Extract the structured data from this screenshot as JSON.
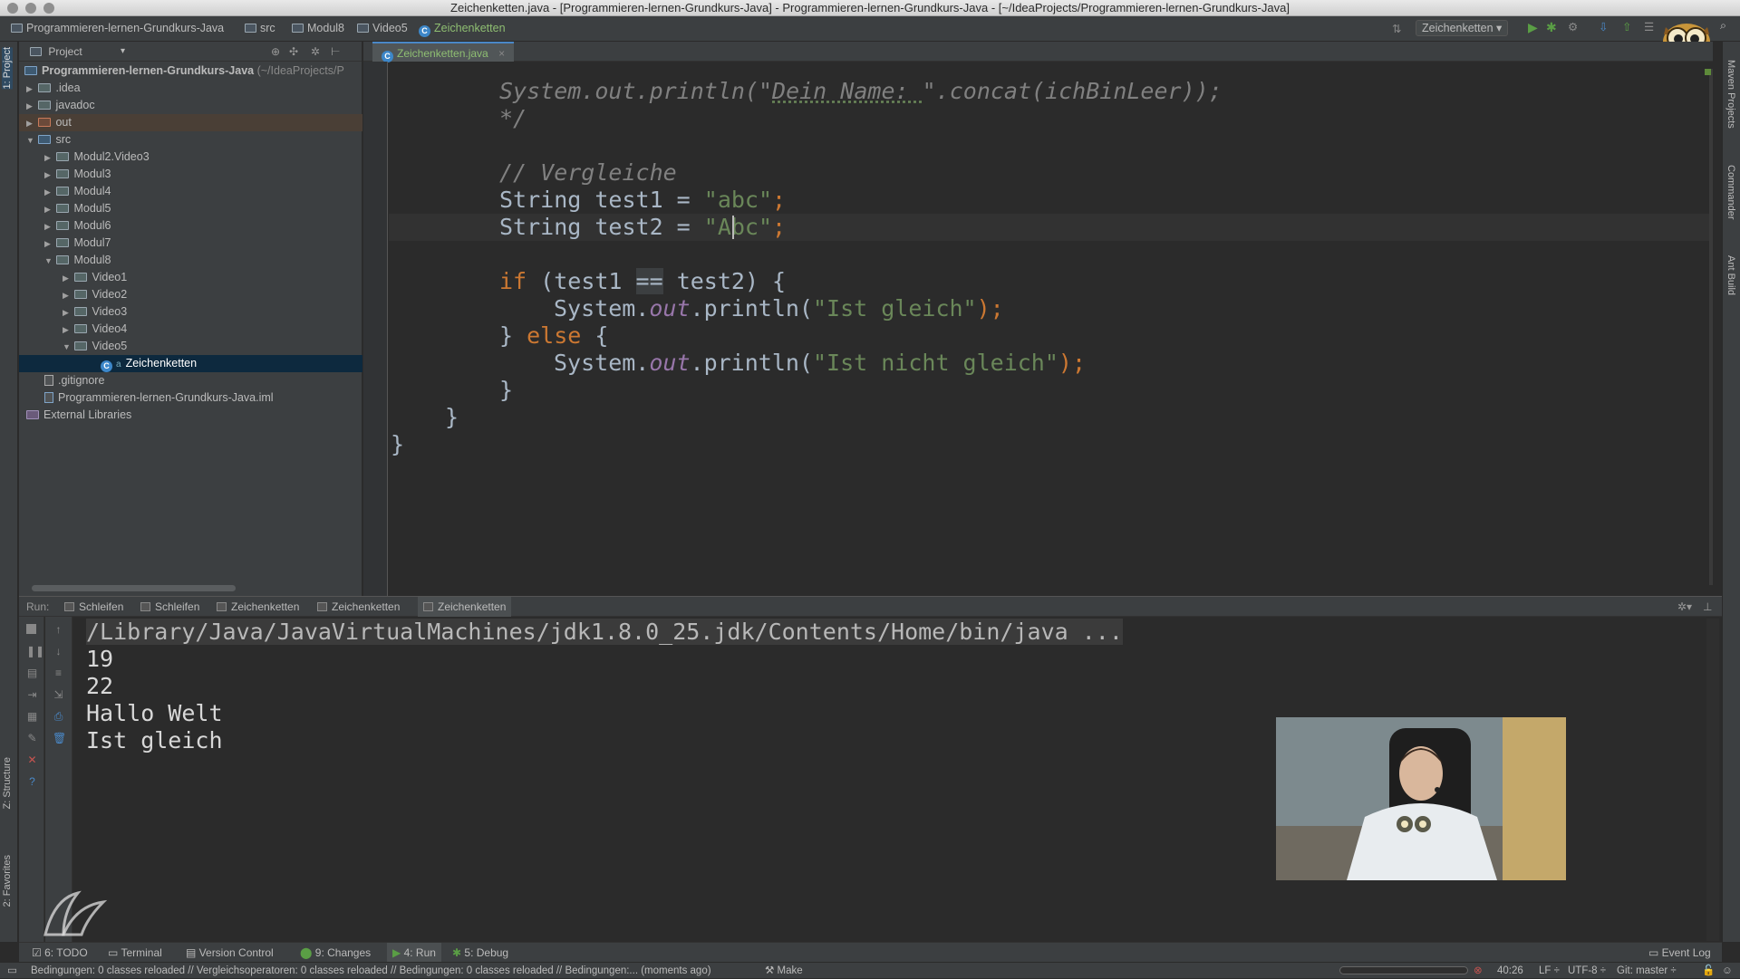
{
  "window": {
    "title": "Zeichenketten.java - [Programmieren-lernen-Grundkurs-Java] - Programmieren-lernen-Grundkurs-Java - [~/IdeaProjects/Programmieren-lernen-Grundkurs-Java]"
  },
  "breadcrumb": [
    "Programmieren-lernen-Grundkurs-Java",
    "src",
    "Modul8",
    "Video5",
    "Zeichenketten"
  ],
  "run_config": "Zeichenketten",
  "side_tabs": {
    "project": "1: Project",
    "structure": "Z: Structure",
    "favorites": "2: Favorites",
    "maven": "Maven Projects",
    "commander": "Commander",
    "ant": "Ant Build"
  },
  "project_panel": {
    "header": "Project",
    "root": "Programmieren-lernen-Grundkurs-Java",
    "root_path": "(~/IdeaProjects/P",
    "items": [
      {
        "label": ".idea"
      },
      {
        "label": "javadoc"
      },
      {
        "label": "out"
      },
      {
        "label": "src"
      },
      {
        "label": "Modul2.Video3"
      },
      {
        "label": "Modul3"
      },
      {
        "label": "Modul4"
      },
      {
        "label": "Modul5"
      },
      {
        "label": "Modul6"
      },
      {
        "label": "Modul7"
      },
      {
        "label": "Modul8"
      },
      {
        "label": "Video1"
      },
      {
        "label": "Video2"
      },
      {
        "label": "Video3"
      },
      {
        "label": "Video4"
      },
      {
        "label": "Video5"
      },
      {
        "label": "Zeichenketten"
      },
      {
        "label": ".gitignore"
      },
      {
        "label": "Programmieren-lernen-Grundkurs-Java.iml"
      },
      {
        "label": "External Libraries"
      }
    ]
  },
  "editor": {
    "tab": "Zeichenketten.java",
    "code": {
      "l1_a": "System.out.println(\"",
      "l1_b": "Dein Name: ",
      "l1_c": "\".concat(ichBinLeer));",
      "l2": "*/",
      "l3": "// Vergleiche",
      "l4_a": "String test1 = ",
      "l4_b": "\"abc\"",
      "l4_c": ";",
      "l5_a": "String test2 = ",
      "l5_b": "\"Abc\"",
      "l5_c": ";",
      "l6_kw": "if",
      "l6_a": " (test1 ",
      "l6_op": "==",
      "l6_b": " test2) {",
      "l7_a": "System.",
      "l7_out": "out",
      "l7_b": ".println(",
      "l7_str": "\"Ist gleich\"",
      "l7_c": ");",
      "l8_a": "} ",
      "l8_kw": "else",
      "l8_b": " {",
      "l9_a": "System.",
      "l9_out": "out",
      "l9_b": ".println(",
      "l9_str": "\"Ist nicht gleich\"",
      "l9_c": ");",
      "l10": "}",
      "l11": "}",
      "l12": "}"
    }
  },
  "run": {
    "label": "Run:",
    "tabs": [
      "Schleifen",
      "Schleifen",
      "Zeichenketten",
      "Zeichenketten",
      "Zeichenketten"
    ],
    "output": [
      "/Library/Java/JavaVirtualMachines/jdk1.8.0_25.jdk/Contents/Home/bin/java ...",
      "19",
      "22",
      "Hallo Welt",
      "Ist gleich"
    ]
  },
  "bottom_tabs": {
    "todo": "6: TODO",
    "terminal": "Terminal",
    "vcs": "Version Control",
    "changes": "9: Changes",
    "run": "4: Run",
    "debug": "5: Debug",
    "event_log": "Event Log"
  },
  "status": {
    "message": "Bedingungen: 0 classes reloaded // Vergleichsoperatoren: 0 classes reloaded // Bedingungen: 0 classes reloaded // Bedingungen:... (moments ago)",
    "make": "Make",
    "position": "40:26",
    "line_sep": "LF",
    "encoding": "UTF-8",
    "git": "Git: master"
  },
  "colors": {
    "keyword": "#cc7832",
    "string": "#6a8759",
    "comment": "#808080",
    "static_field": "#9876aa",
    "selection": "#0d293e"
  }
}
